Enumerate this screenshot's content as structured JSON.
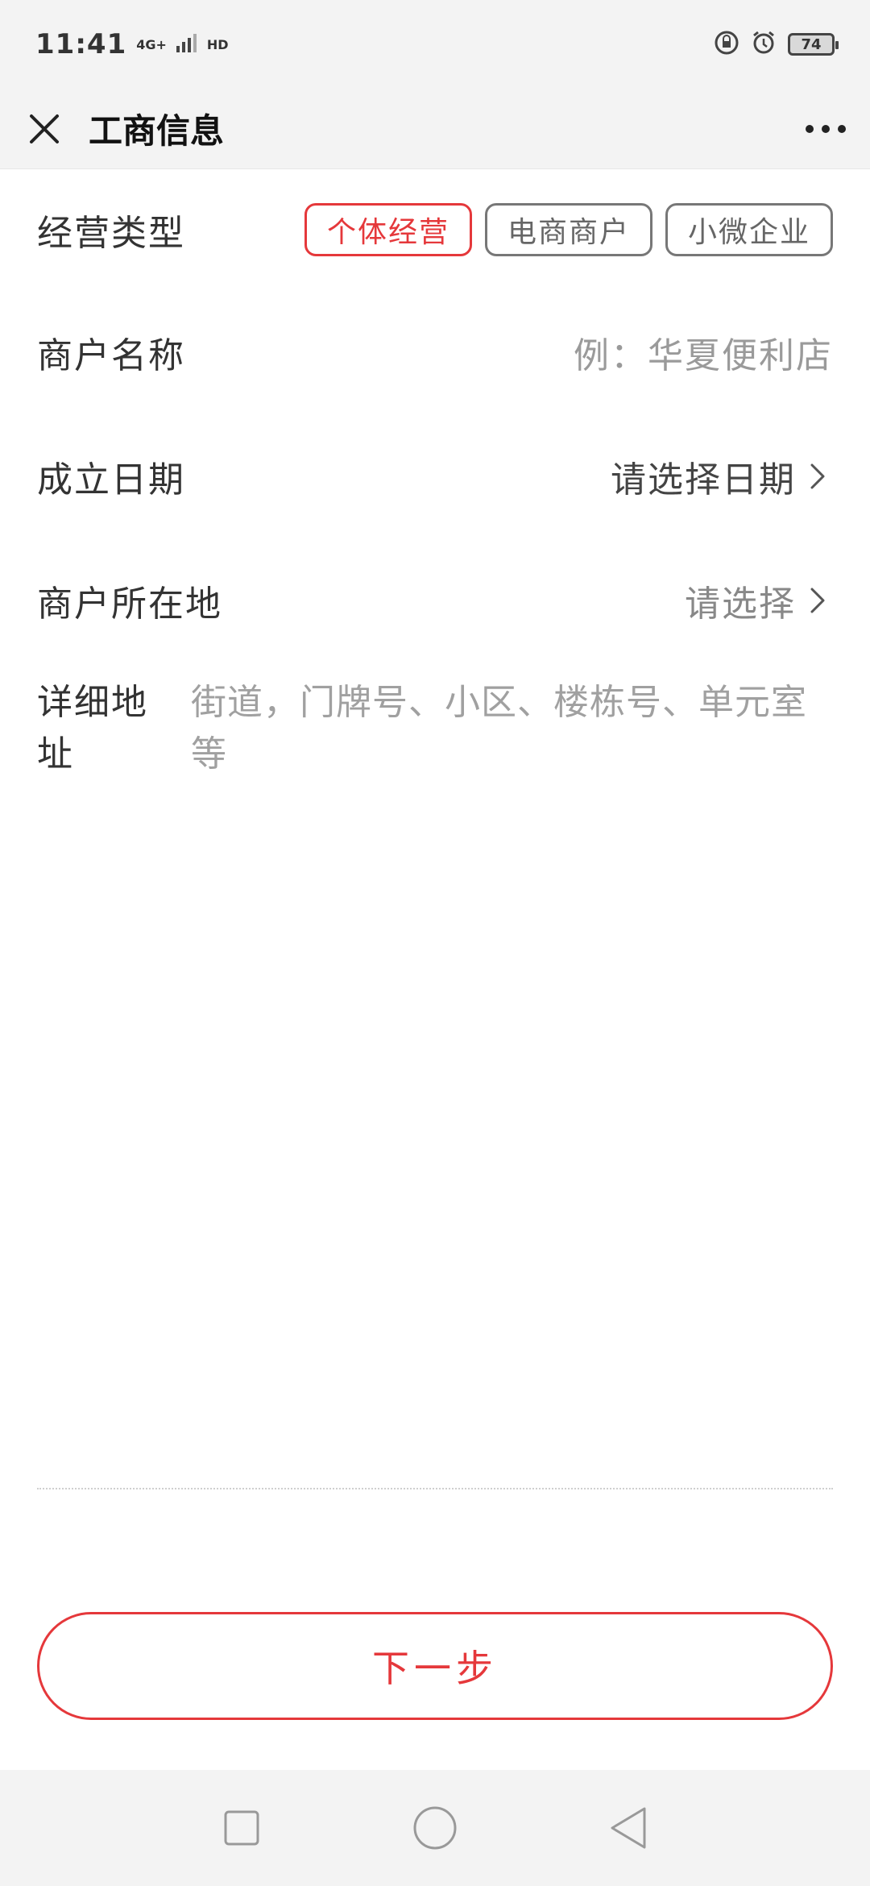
{
  "status": {
    "time": "11:41",
    "network": "4G+",
    "hd": "HD",
    "battery": "74"
  },
  "nav": {
    "title": "工商信息"
  },
  "form": {
    "business_type": {
      "label": "经营类型",
      "options": [
        "个体经营",
        "电商商户",
        "小微企业"
      ],
      "selected": "个体经营"
    },
    "merchant_name": {
      "label": "商户名称",
      "placeholder": "例：华夏便利店"
    },
    "established_date": {
      "label": "成立日期",
      "placeholder": "请选择日期"
    },
    "location": {
      "label": "商户所在地",
      "placeholder": "请选择"
    },
    "address": {
      "label": "详细地址",
      "placeholder": "街道，门牌号、小区、楼栋号、单元室等"
    }
  },
  "actions": {
    "next_label": "下一步"
  },
  "colors": {
    "accent": "#e5383b"
  }
}
